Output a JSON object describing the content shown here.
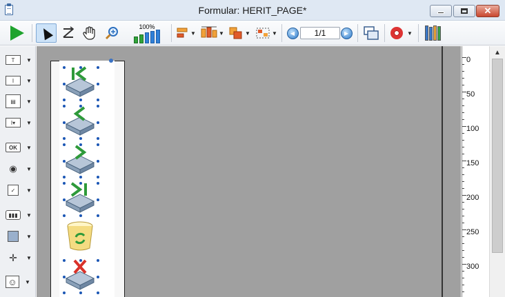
{
  "window": {
    "title": "Formular: HERIT_PAGE*",
    "controls": {
      "minimize": "—",
      "maximize": "▢",
      "close": "✕"
    }
  },
  "toolbar": {
    "zoom_label": "100%",
    "page_indicator": "1/1",
    "icons": [
      "play-icon",
      "pointer-icon",
      "tab-order-icon",
      "hand-icon",
      "magnifier-icon",
      "zoom-bars-icon",
      "align-icon",
      "distribute-icon",
      "layer-icon",
      "grid-select-icon",
      "prev-page-icon",
      "next-page-icon",
      "windows-icon",
      "help-lifebuoy-icon",
      "library-icon"
    ]
  },
  "object_palette": {
    "items": [
      {
        "name": "text-object",
        "glyph": "T"
      },
      {
        "name": "input-field",
        "glyph": "I"
      },
      {
        "name": "list-box",
        "glyph": "▤"
      },
      {
        "name": "combo-box",
        "glyph": "I▾"
      },
      {
        "name": "button",
        "glyph": "OK"
      },
      {
        "name": "radio-button",
        "glyph": "◉"
      },
      {
        "name": "check-box",
        "glyph": "✓"
      },
      {
        "name": "progress-indicator",
        "glyph": "▮▮▮"
      },
      {
        "name": "rectangle",
        "glyph": ""
      },
      {
        "name": "splitter",
        "glyph": "✛"
      },
      {
        "name": "plugin-area",
        "glyph": "☺"
      }
    ]
  },
  "form_objects": [
    {
      "name": "first-record-button",
      "glyph": "|<"
    },
    {
      "name": "previous-record-button",
      "glyph": "<"
    },
    {
      "name": "next-record-button",
      "glyph": ">"
    },
    {
      "name": "last-record-button",
      "glyph": ">|"
    },
    {
      "name": "cancel-button",
      "glyph": "recycle"
    },
    {
      "name": "delete-record-button",
      "glyph": "✕"
    }
  ],
  "ruler": {
    "labels": [
      "0",
      "50",
      "100",
      "150",
      "200",
      "250",
      "300"
    ]
  },
  "colors": {
    "titlebar": "#dfe8f3",
    "canvas": "#a0a0a0",
    "selection": "#1c57b5",
    "run_green": "#1fa32e"
  }
}
